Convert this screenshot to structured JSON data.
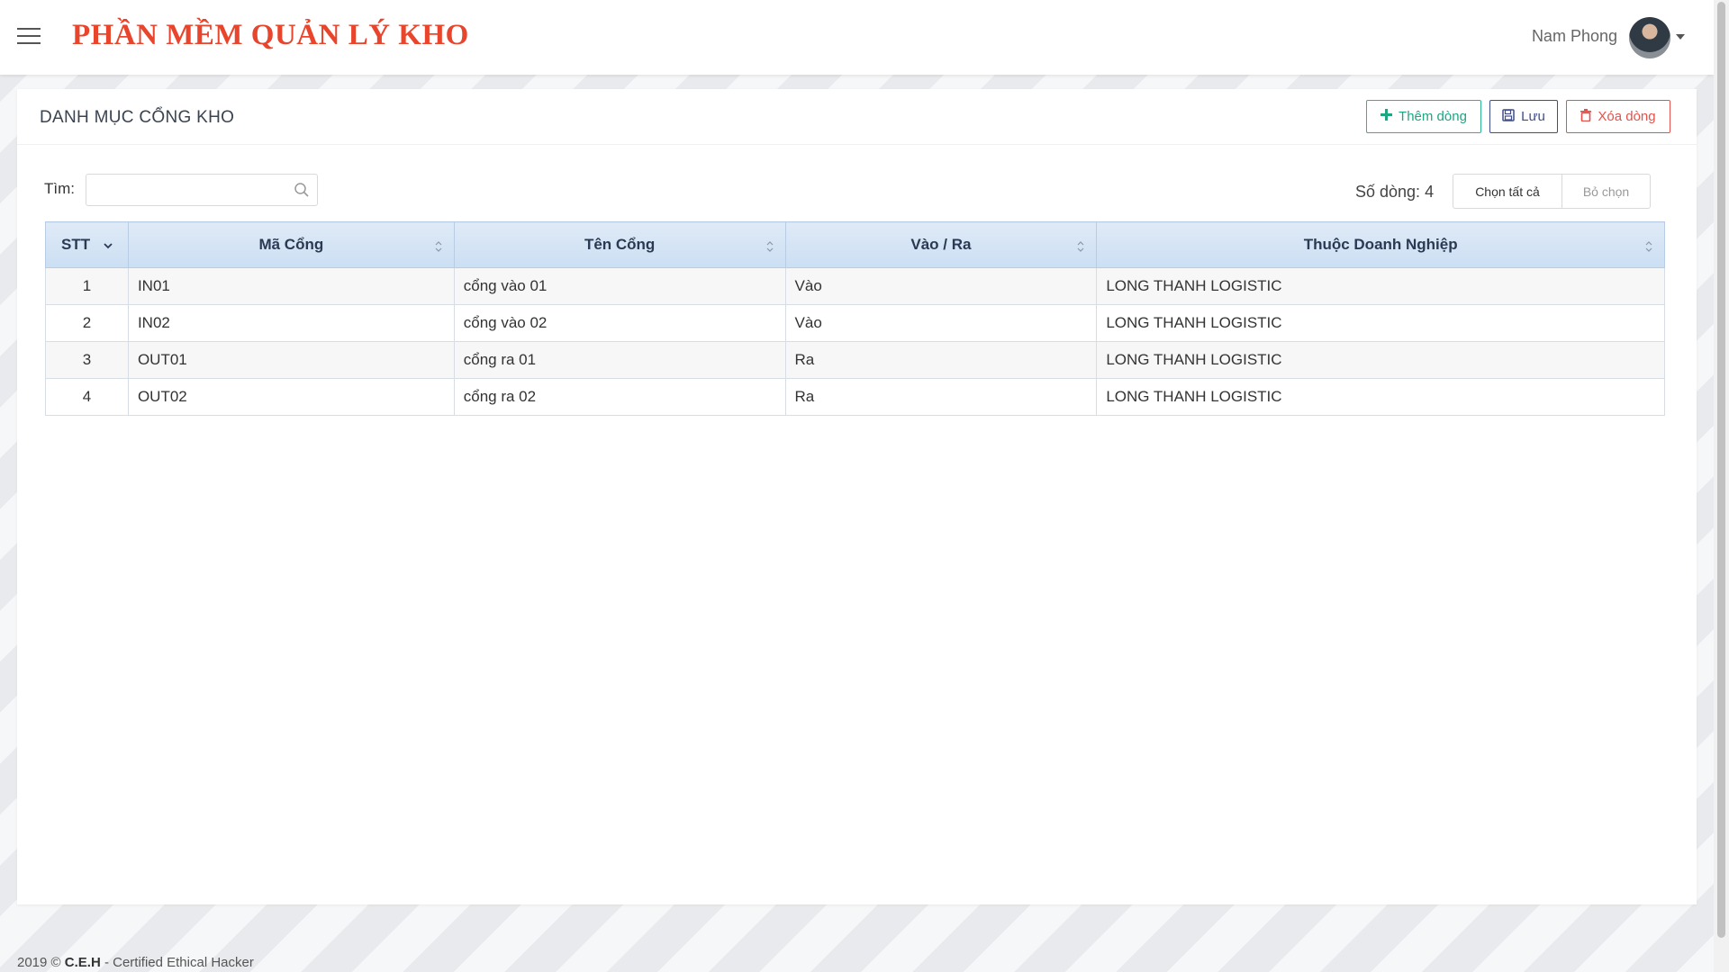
{
  "header": {
    "app_title": "PHẦN MỀM QUẢN LÝ KHO",
    "user_name": "Nam Phong"
  },
  "panel": {
    "title": "DANH MỤC CỔNG KHO",
    "buttons": {
      "add": "Thêm dòng",
      "save": "Lưu",
      "delete": "Xóa dòng"
    }
  },
  "search": {
    "label": "Tìm:",
    "value": "",
    "placeholder": ""
  },
  "toolbar": {
    "row_count": "Số dòng: 4",
    "select_all": "Chọn tất cả",
    "deselect": "Bỏ chọn"
  },
  "table": {
    "columns": [
      "STT",
      "Mã Cổng",
      "Tên Cổng",
      "Vào / Ra",
      "Thuộc Doanh Nghiệp"
    ],
    "rows": [
      [
        "1",
        "IN01",
        "cổng vào 01",
        "Vào",
        "LONG THANH LOGISTIC"
      ],
      [
        "2",
        "IN02",
        "cổng vào 02",
        "Vào",
        "LONG THANH LOGISTIC"
      ],
      [
        "3",
        "OUT01",
        "cổng ra 01",
        "Ra",
        "LONG THANH LOGISTIC"
      ],
      [
        "4",
        "OUT02",
        "cổng ra 02",
        "Ra",
        "LONG THANH LOGISTIC"
      ]
    ]
  },
  "footer": {
    "year": "2019 ©",
    "brand": "C.E.H",
    "text": "- Certified Ethical Hacker"
  },
  "colors": {
    "brand_red": "#e8452c",
    "add_green": "#1ea582",
    "save_navy": "#3f4d8c",
    "delete_red": "#e4524b"
  },
  "icons": {
    "menu": "hamburger-icon",
    "search": "search-icon",
    "add": "plus-icon",
    "save": "floppy-icon",
    "delete": "trash-icon",
    "sort": "sort-icon",
    "sort_active": "chevron-down-icon",
    "user_menu": "caret-down-icon"
  }
}
